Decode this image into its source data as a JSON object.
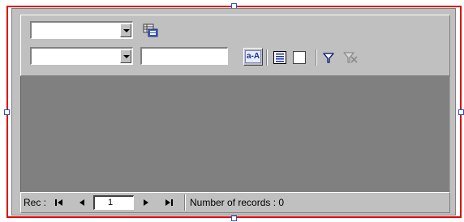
{
  "toolbar": {
    "combo1_value": "",
    "combo2_value": "",
    "text_value": "",
    "case_button_label": "a-A",
    "icons": [
      "grid-settings-icon",
      "list-icon",
      "checkbox",
      "filter-icon",
      "clear-filter-icon"
    ]
  },
  "status": {
    "rec_label": "Rec :",
    "current_record": "1",
    "records_label": "Number of records : 0"
  },
  "colors": {
    "selection_frame": "#e00000",
    "control_face": "#c0c0c0",
    "data_area": "#808080"
  }
}
